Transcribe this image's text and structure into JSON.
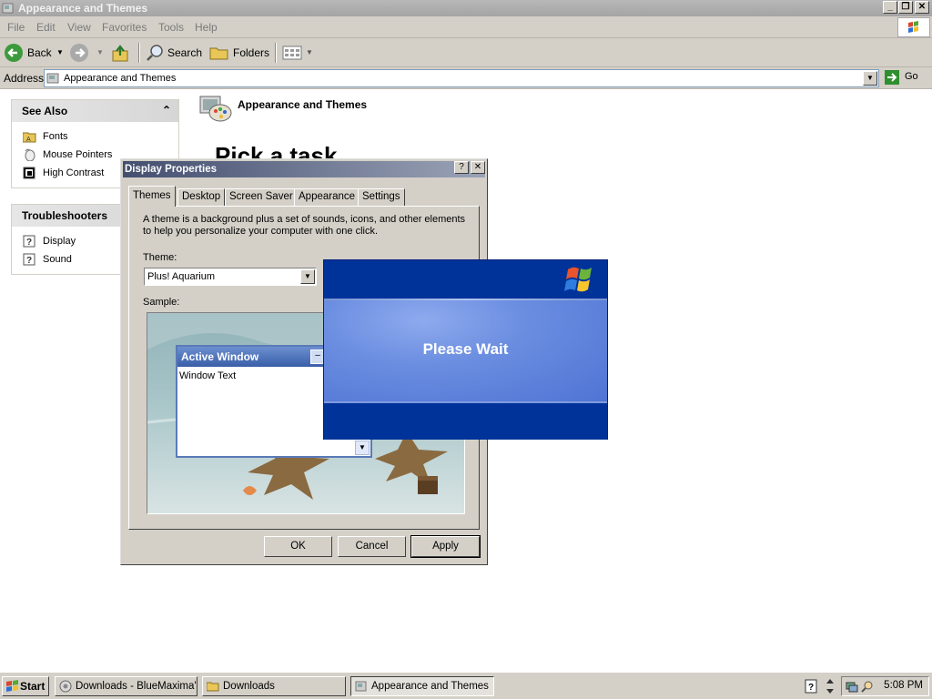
{
  "window": {
    "title": "Appearance and Themes"
  },
  "menu": {
    "items": [
      "File",
      "Edit",
      "View",
      "Favorites",
      "Tools",
      "Help"
    ]
  },
  "toolbar": {
    "back_label": "Back",
    "search_label": "Search",
    "folders_label": "Folders"
  },
  "address": {
    "label": "Address",
    "value": "Appearance and Themes",
    "go_label": "Go"
  },
  "see_also": {
    "title": "See Also",
    "items": [
      {
        "label": "Fonts",
        "icon": "folder-fonts-icon"
      },
      {
        "label": "Mouse Pointers",
        "icon": "mouse-icon"
      },
      {
        "label": "High Contrast",
        "icon": "contrast-icon"
      }
    ]
  },
  "troubleshooters": {
    "title": "Troubleshooters",
    "items": [
      {
        "label": "Display",
        "icon": "help-icon"
      },
      {
        "label": "Sound",
        "icon": "help-icon"
      }
    ]
  },
  "main": {
    "title": "Appearance and Themes",
    "heading": "Pick a task"
  },
  "dialog": {
    "title": "Display Properties",
    "tabs": [
      "Themes",
      "Desktop",
      "Screen Saver",
      "Appearance",
      "Settings"
    ],
    "active_tab": "Themes",
    "description": "A theme is a background plus a set of sounds, icons, and other elements to help you personalize your computer with one click.",
    "theme_label": "Theme:",
    "theme_value": "Plus! Aquarium",
    "sample_label": "Sample:",
    "sample_window_title": "Active Window",
    "sample_window_text": "Window Text",
    "buttons": {
      "ok": "OK",
      "cancel": "Cancel",
      "apply": "Apply"
    }
  },
  "splash": {
    "message": "Please Wait"
  },
  "taskbar": {
    "start_label": "Start",
    "tasks": [
      {
        "label": "Downloads - BlueMaxima'...",
        "active": false
      },
      {
        "label": "Downloads",
        "active": false
      },
      {
        "label": "Appearance and Themes",
        "active": true
      }
    ],
    "clock": "5:08 PM"
  },
  "colors": {
    "splash_blue": "#003399",
    "splash_mid": "#6a8de0",
    "dialog_title": "#444e6f"
  }
}
